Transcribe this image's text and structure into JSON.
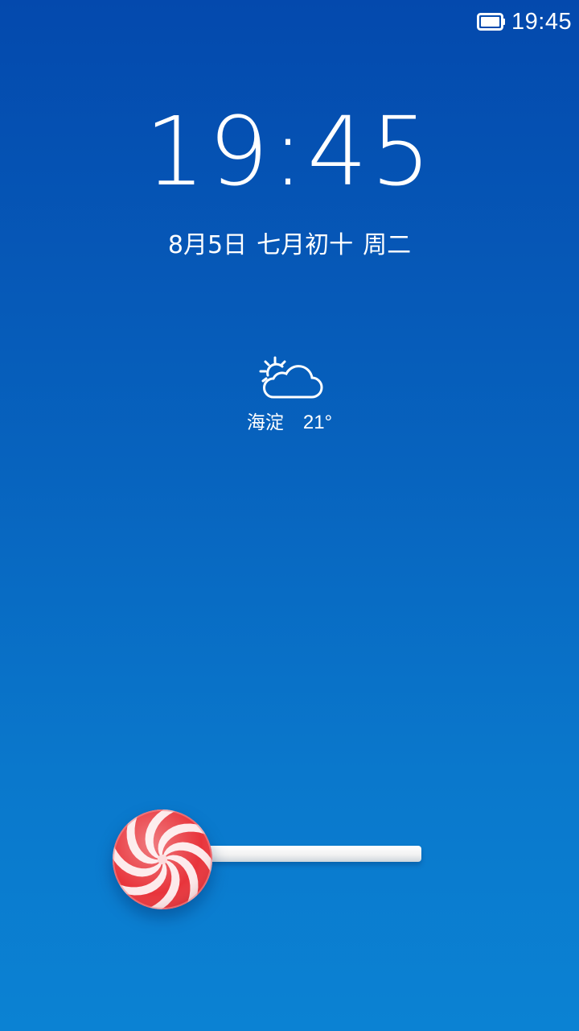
{
  "status_bar": {
    "time": "19:45",
    "battery_icon": "battery-full-icon"
  },
  "lockscreen": {
    "clock": "19:45",
    "date": {
      "solar": "8月5日",
      "lunar": "七月初十",
      "weekday": "周二"
    },
    "weather": {
      "icon": "partly-cloudy-icon",
      "location": "海淀",
      "temperature": "21°"
    },
    "unlock": {
      "handle_icon": "lollipop-icon"
    }
  },
  "colors": {
    "background_top": "#0449ad",
    "background_bottom": "#0b82d3",
    "text": "#ffffff",
    "candy_red": "#e8343b",
    "candy_white": "#ffffff"
  }
}
